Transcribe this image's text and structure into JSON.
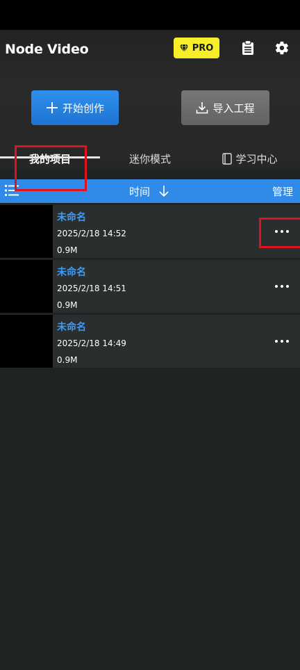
{
  "app": {
    "title": "Node Video",
    "pro_label": "PRO"
  },
  "actions": {
    "create_label": "开始创作",
    "import_label": "导入工程"
  },
  "tabs": [
    {
      "label": "我的项目",
      "active": true
    },
    {
      "label": "迷你模式",
      "active": false
    },
    {
      "label": "学习中心",
      "active": false
    }
  ],
  "sort_bar": {
    "sort_label": "时间",
    "manage_label": "管理"
  },
  "projects": [
    {
      "name": "未命名",
      "date": "2025/2/18 14:52",
      "size": "0.9M"
    },
    {
      "name": "未命名",
      "date": "2025/2/18 14:51",
      "size": "0.9M"
    },
    {
      "name": "未命名",
      "date": "2025/2/18 14:49",
      "size": "0.9M"
    }
  ],
  "icons": {
    "pro": "diamond-icon",
    "clipboard": "clipboard-icon",
    "settings": "gear-icon",
    "create": "plus-icon",
    "import": "download-icon",
    "learn": "book-icon",
    "list": "list-icon",
    "sort": "arrow-down-icon",
    "more": "more-icon"
  },
  "colors": {
    "accent_blue": "#2f8ae8",
    "project_name": "#3d9bf5",
    "pro_badge": "#f6ef2a",
    "highlight": "#e0121e"
  }
}
